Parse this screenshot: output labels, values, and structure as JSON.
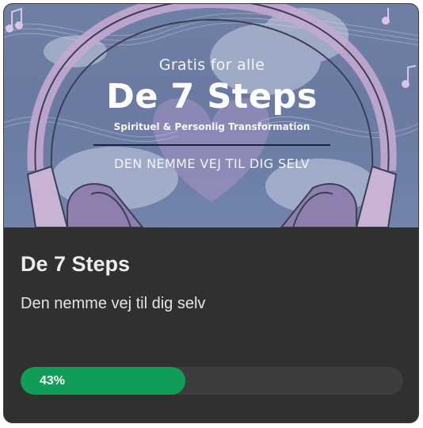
{
  "banner": {
    "free_text": "Gratis for alle",
    "title": "De 7 Steps",
    "subtitle": "Spirituel & Personlig Transformation",
    "tagline": "DEN NEMME VEJ TIL DIG SELV",
    "image_description": "headphones-heart-clouds-illustration"
  },
  "course": {
    "title": "De 7 Steps",
    "description": "Den nemme vej til dig selv"
  },
  "progress": {
    "value": 0.43,
    "label": "43%"
  },
  "colors": {
    "card_bg": "#303030",
    "banner_bg": "#6f7fa5",
    "progress_fill": "#0f9d58",
    "progress_track": "#3d3d3d"
  }
}
